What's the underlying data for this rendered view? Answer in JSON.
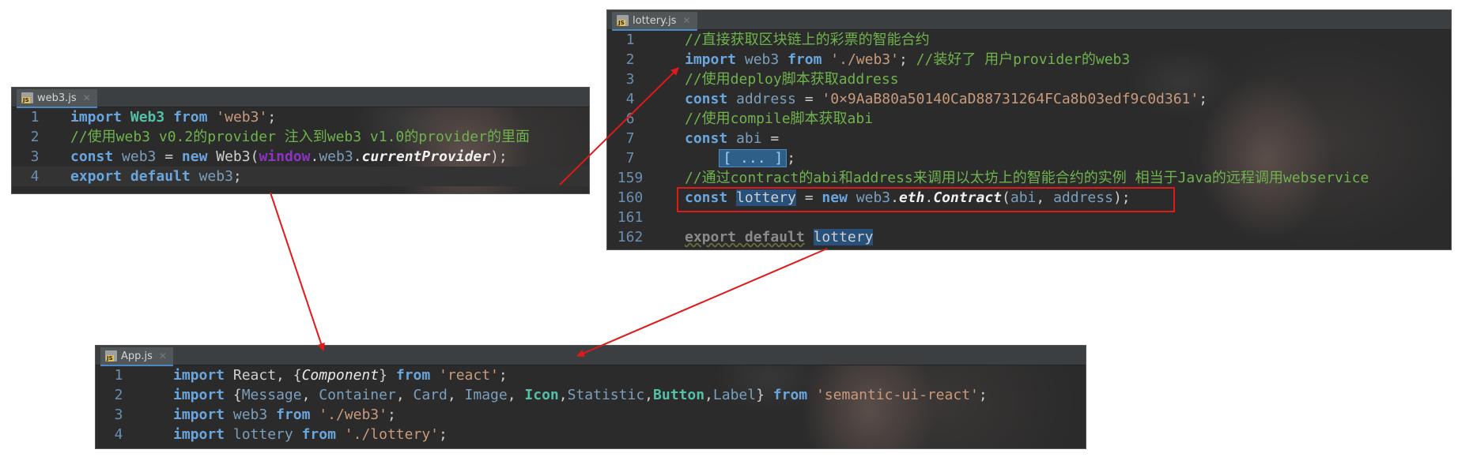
{
  "web3_panel": {
    "tab": "web3.js",
    "lines": [
      {
        "n": "1",
        "parts": [
          [
            "kw",
            "import"
          ],
          [
            "p",
            " "
          ],
          [
            "cls",
            "Web3"
          ],
          [
            "p",
            " "
          ],
          [
            "kw",
            "from"
          ],
          [
            "p",
            " "
          ],
          [
            "str",
            "'web3'"
          ],
          [
            "p",
            ";"
          ]
        ]
      },
      {
        "n": "2",
        "parts": [
          [
            "cmt",
            "//使用web3 v0.2的provider 注入到web3 v1.0的provider的里面"
          ]
        ]
      },
      {
        "n": "3",
        "parts": [
          [
            "kw",
            "const"
          ],
          [
            "p",
            " "
          ],
          [
            "var",
            "web3"
          ],
          [
            "p",
            " = "
          ],
          [
            "kw",
            "new"
          ],
          [
            "p",
            " Web3("
          ],
          [
            "win",
            "window"
          ],
          [
            "p",
            "."
          ],
          [
            "var",
            "web3"
          ],
          [
            "p",
            "."
          ],
          [
            "it",
            "currentProvider"
          ],
          [
            "p",
            ");"
          ]
        ]
      },
      {
        "n": "4",
        "parts": [
          [
            "kw",
            "export default"
          ],
          [
            "p",
            " "
          ],
          [
            "var",
            "web3"
          ],
          [
            "p",
            ";"
          ]
        ]
      }
    ]
  },
  "lottery_panel": {
    "tab": "lottery.js",
    "lines": [
      {
        "n": "1",
        "parts": [
          [
            "cmt",
            "//直接获取区块链上的彩票的智能合约"
          ]
        ]
      },
      {
        "n": "2",
        "parts": [
          [
            "kw",
            "import"
          ],
          [
            "p",
            " "
          ],
          [
            "var",
            "web3"
          ],
          [
            "p",
            " "
          ],
          [
            "kw",
            "from"
          ],
          [
            "p",
            " "
          ],
          [
            "str",
            "'./web3'"
          ],
          [
            "p",
            "; "
          ],
          [
            "cmt",
            "//装好了 用户provider的web3"
          ]
        ]
      },
      {
        "n": "3",
        "parts": [
          [
            "cmt",
            "//使用deploy脚本获取address"
          ]
        ]
      },
      {
        "n": "4",
        "parts": [
          [
            "kw",
            "const"
          ],
          [
            "p",
            " "
          ],
          [
            "var",
            "address"
          ],
          [
            "p",
            " = "
          ],
          [
            "str",
            "'0×9AaB80a50140CaD88731264FCa8b03edf9c0d361'"
          ],
          [
            "p",
            ";"
          ]
        ]
      },
      {
        "n": "6",
        "parts": [
          [
            "cmt",
            "//使用compile脚本获取abi"
          ]
        ]
      },
      {
        "n": "7",
        "parts": [
          [
            "kw",
            "const"
          ],
          [
            "p",
            " "
          ],
          [
            "var",
            "abi"
          ],
          [
            "p",
            " ="
          ]
        ]
      },
      {
        "n": "7",
        "parts": [
          [
            "p",
            "    "
          ],
          [
            "fold",
            "[ ... ]"
          ],
          [
            "p",
            ";"
          ]
        ]
      },
      {
        "n": "159",
        "parts": [
          [
            "cmt",
            "//通过contract的abi和address来调用以太坊上的智能合约的实例 相当于Java的远程调用webservice"
          ]
        ]
      },
      {
        "n": "160",
        "parts": [
          [
            "kw",
            "const"
          ],
          [
            "p",
            " "
          ],
          [
            "hl",
            "lottery"
          ],
          [
            "p",
            " = "
          ],
          [
            "kw",
            "new"
          ],
          [
            "p",
            " "
          ],
          [
            "var",
            "web3"
          ],
          [
            "p",
            "."
          ],
          [
            "it",
            "eth"
          ],
          [
            "p",
            "."
          ],
          [
            "it",
            "Contract"
          ],
          [
            "p",
            "("
          ],
          [
            "var",
            "abi"
          ],
          [
            "p",
            ", "
          ],
          [
            "var",
            "address"
          ],
          [
            "p",
            ");"
          ]
        ]
      },
      {
        "n": "161",
        "parts": []
      },
      {
        "n": "162",
        "parts": [
          [
            "dim",
            "export default"
          ],
          [
            "p",
            " "
          ],
          [
            "hl",
            "lottery"
          ]
        ]
      }
    ]
  },
  "app_panel": {
    "tab": "App.js",
    "lines": [
      {
        "n": "1",
        "parts": [
          [
            "kw",
            "import"
          ],
          [
            "p",
            " React, {"
          ],
          [
            "iti",
            "Component"
          ],
          [
            "p",
            "} "
          ],
          [
            "kw",
            "from"
          ],
          [
            "p",
            " "
          ],
          [
            "str",
            "'react'"
          ],
          [
            "p",
            ";"
          ]
        ]
      },
      {
        "n": "2",
        "parts": [
          [
            "kw",
            "import"
          ],
          [
            "p",
            " {"
          ],
          [
            "var",
            "Message"
          ],
          [
            "p",
            ", "
          ],
          [
            "var",
            "Container"
          ],
          [
            "p",
            ", "
          ],
          [
            "var",
            "Card"
          ],
          [
            "p",
            ", "
          ],
          [
            "var",
            "Image"
          ],
          [
            "p",
            ", "
          ],
          [
            "cls",
            "Icon"
          ],
          [
            "p",
            ","
          ],
          [
            "var",
            "Statistic"
          ],
          [
            "p",
            ","
          ],
          [
            "cls",
            "Button"
          ],
          [
            "p",
            ","
          ],
          [
            "var",
            "Label"
          ],
          [
            "p",
            "} "
          ],
          [
            "kw",
            "from"
          ],
          [
            "p",
            " "
          ],
          [
            "str",
            "'semantic-ui-react'"
          ],
          [
            "p",
            ";"
          ]
        ]
      },
      {
        "n": "3",
        "parts": [
          [
            "kw",
            "import"
          ],
          [
            "p",
            " "
          ],
          [
            "var",
            "web3"
          ],
          [
            "p",
            " "
          ],
          [
            "kw",
            "from"
          ],
          [
            "p",
            " "
          ],
          [
            "str",
            "'./web3'"
          ],
          [
            "p",
            ";"
          ]
        ]
      },
      {
        "n": "4",
        "parts": [
          [
            "kw",
            "import"
          ],
          [
            "p",
            " "
          ],
          [
            "var",
            "lottery"
          ],
          [
            "p",
            " "
          ],
          [
            "kw",
            "from"
          ],
          [
            "p",
            " "
          ],
          [
            "str",
            "'./lottery'"
          ],
          [
            "p",
            ";"
          ]
        ]
      }
    ]
  },
  "colors": {
    "arrow": "#e01919",
    "editor_bg": "#2b2b2b"
  }
}
